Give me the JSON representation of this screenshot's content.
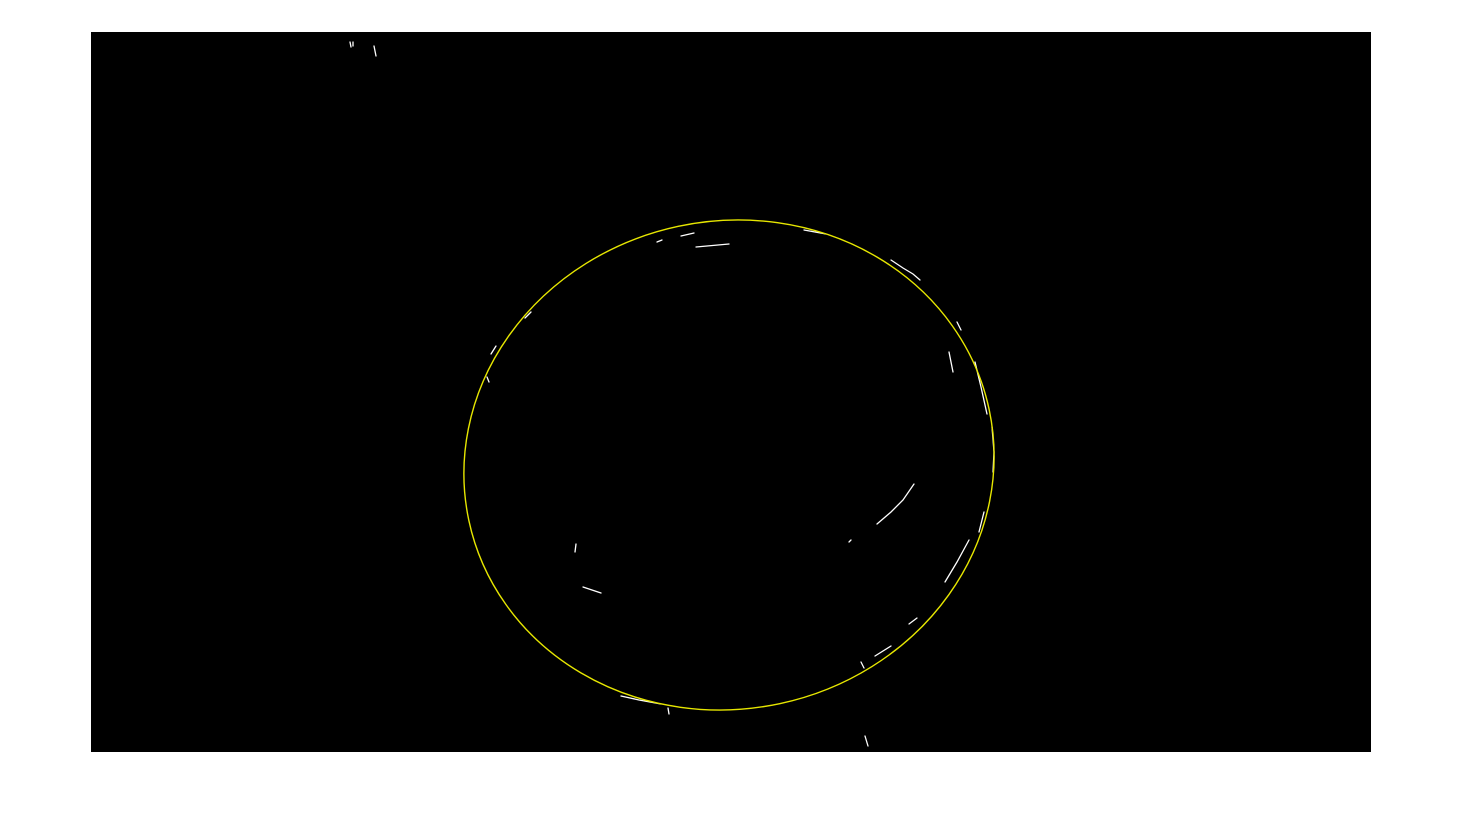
{
  "image": {
    "description_colors": {
      "background": "#000000",
      "edges": "#ffffff",
      "fitted_ellipse": "#e6e600",
      "canvas": "#ffffff"
    }
  }
}
